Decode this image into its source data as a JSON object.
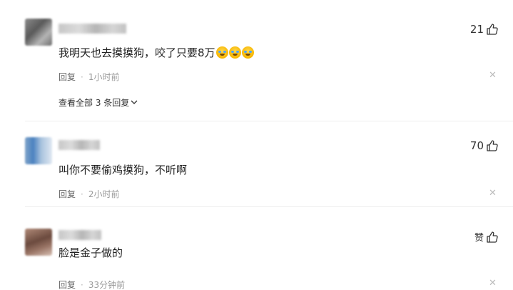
{
  "comments": [
    {
      "text": "我明天也去摸摸狗，咬了只要8万",
      "emoji_icons": [
        "crying-laughing-emoji",
        "crying-laughing-emoji",
        "crying-laughing-emoji"
      ],
      "reply_label": "回复",
      "separator": "·",
      "time": "1小时前",
      "likes": "21",
      "expand_label": "查看全部 3 条回复"
    },
    {
      "text": "叫你不要偷鸡摸狗，不听啊",
      "reply_label": "回复",
      "separator": "·",
      "time": "2小时前",
      "likes": "70"
    },
    {
      "text": "脸是金子做的",
      "reply_label": "回复",
      "separator": "·",
      "time": "33分钟前",
      "likes": "赞"
    }
  ],
  "icons": {
    "like": "thumbs-up-icon",
    "close": "close-icon",
    "chevron": "chevron-down-icon"
  }
}
